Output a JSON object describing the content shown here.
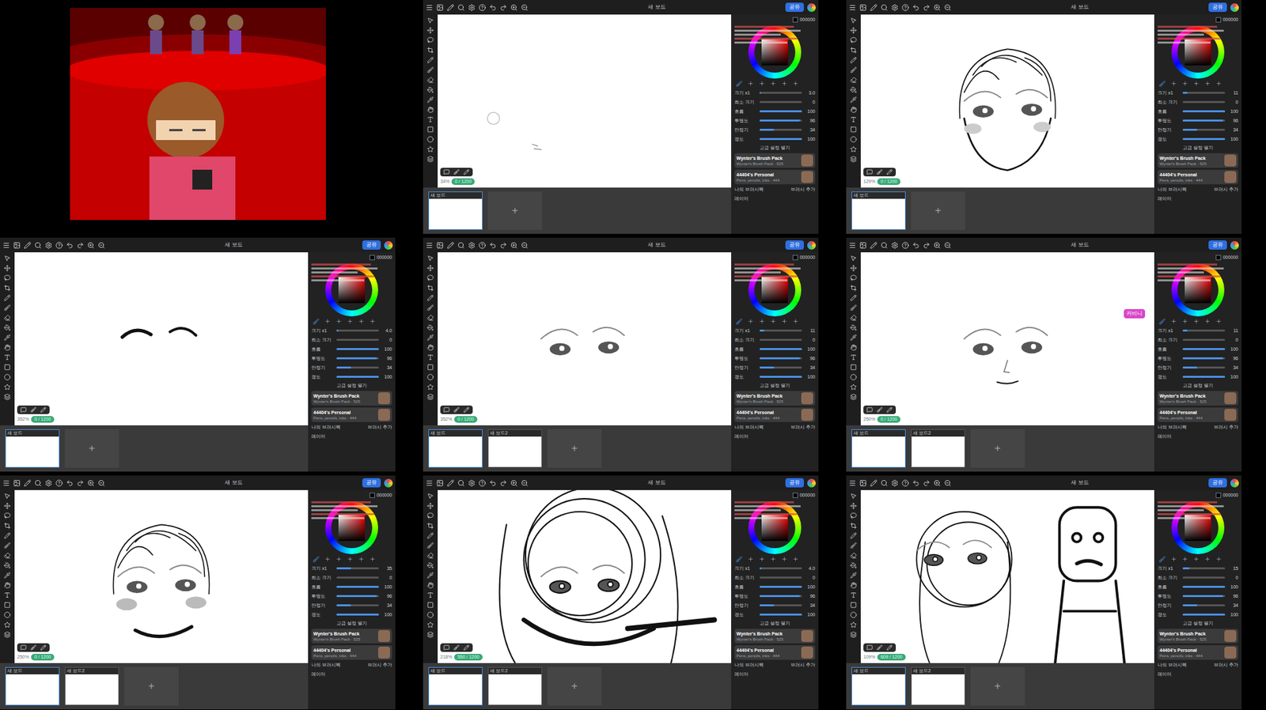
{
  "app": {
    "title": "새 보드",
    "share": "공유",
    "hex": "000000",
    "advanced": "고급 설정 열기",
    "my_packs": "나의 브러시팩",
    "add_brush": "브러시 추가",
    "layers": "레이어",
    "add_board": "+",
    "size_label": "크기 x1",
    "sliders": [
      {
        "label": "최소 크기",
        "value": "0",
        "level": 0
      },
      {
        "label": "흐름",
        "value": "100",
        "level": 1
      },
      {
        "label": "투명도",
        "value": "96",
        "level": 0.96
      },
      {
        "label": "안정기",
        "value": "34",
        "level": 0.34
      },
      {
        "label": "경도",
        "value": "100",
        "level": 1
      }
    ],
    "packs": [
      {
        "name": "Wynter's Brush Pack",
        "sub": "Wynter's Brush Pack · 525"
      },
      {
        "name": "44404's Personal",
        "sub": "Pens, pencils, inks · 444"
      }
    ]
  },
  "video_frame": {
    "kind": "game"
  },
  "frames": [
    {
      "zoom": "34%",
      "counter": "0 / 1200",
      "size": "3.0",
      "size_level": 0.03,
      "sketch": "blank",
      "boards": [
        {
          "label": "새 보드",
          "selected": true
        }
      ],
      "tags": []
    },
    {
      "zoom": "129%",
      "counter": "0 / 1200",
      "size": "11",
      "size_level": 0.11,
      "sketch": "head",
      "boards": [
        {
          "label": "새 보드",
          "selected": true
        }
      ],
      "tags": []
    },
    {
      "zoom": "352%",
      "counter": "0 / 1200",
      "size": "4.0",
      "size_level": 0.04,
      "sketch": "brows",
      "boards": [
        {
          "label": "새 보드",
          "selected": true
        }
      ],
      "tags": []
    },
    {
      "zoom": "352%",
      "counter": "0 / 1200",
      "size": "11",
      "size_level": 0.11,
      "sketch": "eyes",
      "boards": [
        {
          "label": "새 보드",
          "selected": true
        },
        {
          "label": "새 보드2",
          "selected": false
        }
      ],
      "tags": []
    },
    {
      "zoom": "250%",
      "counter": "0 / 1200",
      "size": "11",
      "size_level": 0.11,
      "sketch": "eyes-nose",
      "boards": [
        {
          "label": "새 보드",
          "selected": true
        },
        {
          "label": "새 보드2",
          "selected": false
        }
      ],
      "tags": [
        "커비니"
      ]
    },
    {
      "zoom": "250%",
      "counter": "0 / 1200",
      "size": "35",
      "size_level": 0.35,
      "sketch": "face",
      "boards": [
        {
          "label": "새 보드",
          "selected": true
        },
        {
          "label": "새 보드2",
          "selected": false
        }
      ],
      "tags": []
    },
    {
      "zoom": "218%",
      "counter": "550 / 1200",
      "size": "4.0",
      "size_level": 0.04,
      "sketch": "scribble",
      "boards": [
        {
          "label": "새 보드",
          "selected": true
        },
        {
          "label": "새 보드2",
          "selected": false
        }
      ],
      "tags": []
    },
    {
      "zoom": "109%",
      "counter": "609 / 1200",
      "size": "15",
      "size_level": 0.15,
      "sketch": "figure",
      "boards": [
        {
          "label": "새 보드",
          "selected": true
        },
        {
          "label": "새 보드2",
          "selected": false
        }
      ],
      "tags": []
    }
  ]
}
